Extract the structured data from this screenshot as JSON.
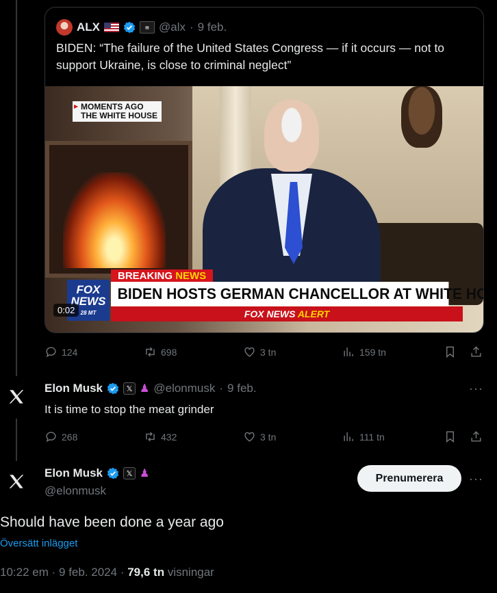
{
  "quoted": {
    "name": "ALX",
    "handle": "@alx",
    "date": "9 feb.",
    "text": "BIDEN: “The failure of the United States Congress — if it occurs — not to support Ukraine, is close to criminal neglect”",
    "video": {
      "tag_line1": "MOMENTS AGO",
      "tag_line2": "THE WHITE HOUSE",
      "breaking_word1": "BREAKING",
      "breaking_word2": "NEWS",
      "headline": "BIDEN HOSTS GERMAN CHANCELLOR AT WHITE HOUSE",
      "alert_brand": "FOX NEWS",
      "alert_word": "ALERT",
      "logo_text": "FOX NEWS",
      "logo_sub": "28 MT",
      "duration": "0:02"
    },
    "stats": {
      "replies": "124",
      "reposts": "698",
      "likes": "3 tn",
      "views": "159 tn"
    }
  },
  "reply_post": {
    "name": "Elon Musk",
    "handle": "@elonmusk",
    "date": "9 feb.",
    "text": "It is time to stop the meat grinder",
    "stats": {
      "replies": "268",
      "reposts": "432",
      "likes": "3 tn",
      "views": "111 tn"
    }
  },
  "main_post": {
    "name": "Elon Musk",
    "handle": "@elonmusk",
    "subscribe_label": "Prenumerera",
    "text": "Should have been done a year ago",
    "translate_label": "Översätt inlägget",
    "time": "10:22 em",
    "date": "9 feb. 2024",
    "views_count": "79,6 tn",
    "views_label": "visningar"
  },
  "icons": [
    "x-logo-icon",
    "verified-icon",
    "reply-icon",
    "repost-icon",
    "like-icon",
    "views-icon",
    "bookmark-icon",
    "share-icon",
    "more-icon"
  ],
  "colors": {
    "background": "#000000",
    "accent": "#1d9bf0",
    "muted": "#71767b",
    "text": "#e7e9ea"
  }
}
